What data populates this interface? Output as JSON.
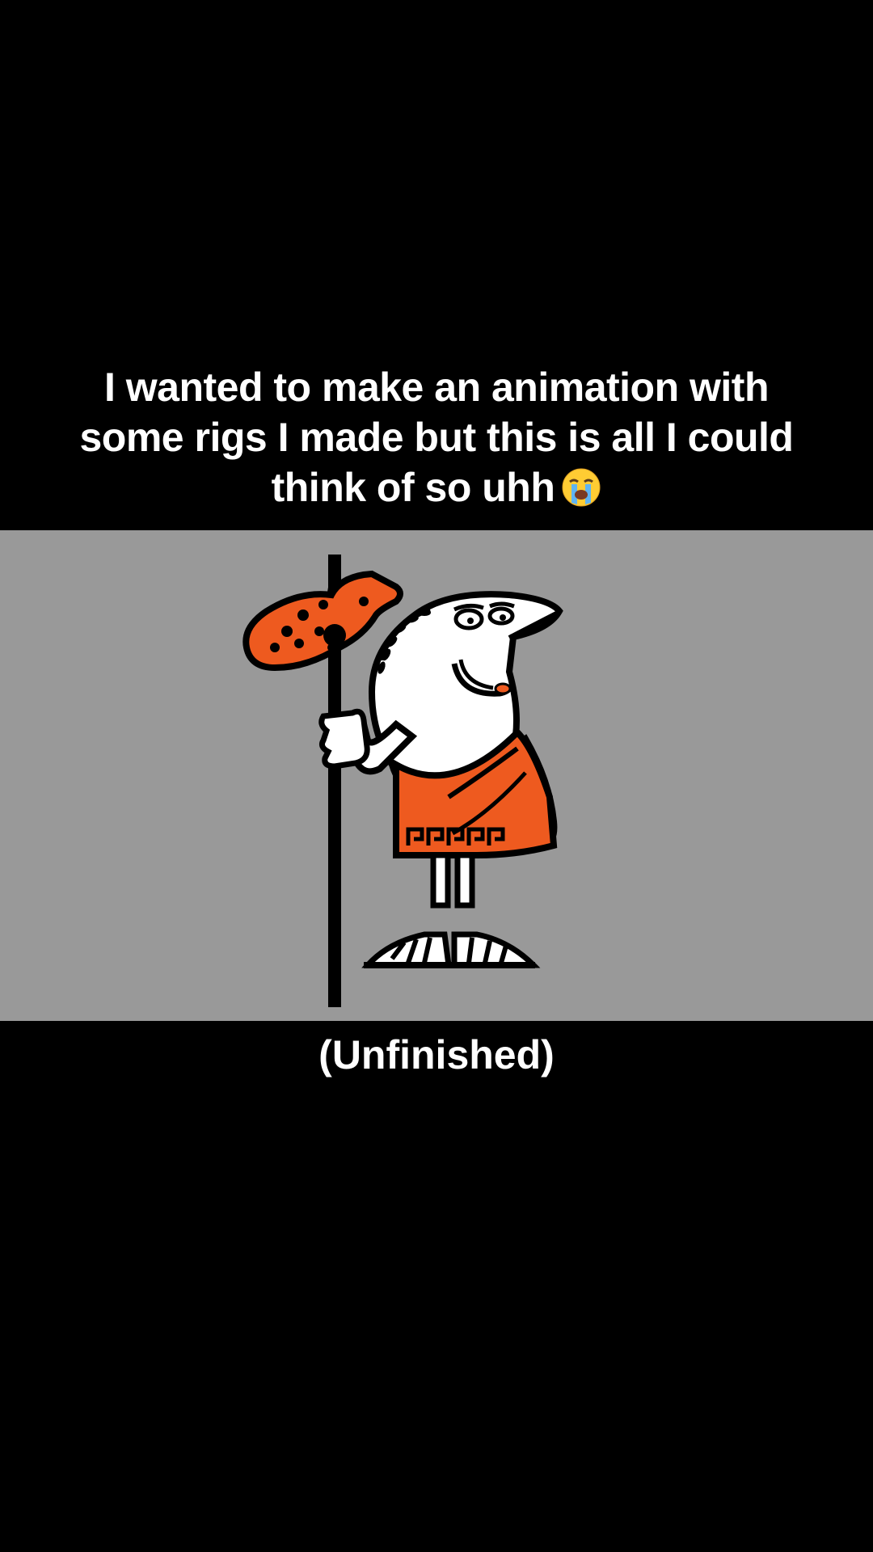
{
  "caption": {
    "lines": [
      "I wanted to make an animation with",
      "some rigs I made but this is all I could",
      "think of so uhh"
    ],
    "emoji": "loudly-crying-face-icon"
  },
  "video": {
    "background": "#999999",
    "subject": "little-caesar-mascot-icon",
    "accent": "#EE5A1F"
  },
  "subtitle": "(Unfinished)"
}
